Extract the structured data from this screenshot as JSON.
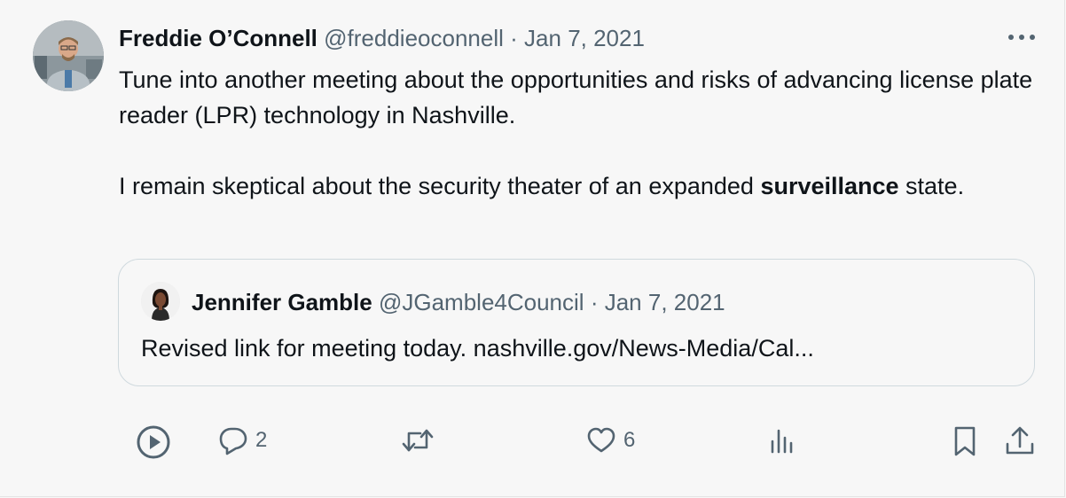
{
  "author": {
    "name": "Freddie O’Connell",
    "handle": "@freddieoconnell",
    "separator": "·",
    "date": "Jan 7, 2021"
  },
  "tweet": {
    "paragraph1": "Tune into another meeting about the opportunities and risks of advancing license plate reader (LPR) technology in Nashville.",
    "paragraph2_before": "I remain skeptical about the security theater of an expanded ",
    "paragraph2_bold": "surveillance",
    "paragraph2_after": " state."
  },
  "quote": {
    "name": "Jennifer Gamble",
    "handle": "@JGamble4Council",
    "separator": "·",
    "date": "Jan 7, 2021",
    "text": "Revised link for meeting today. nashville.gov/News-Media/Cal..."
  },
  "actions": {
    "replies": "2",
    "likes": "6"
  },
  "icons": [
    "play-icon",
    "reply-icon",
    "retweet-icon",
    "like-icon",
    "views-icon",
    "bookmark-icon",
    "share-icon",
    "more-icon"
  ],
  "colors": {
    "text": "#0f1419",
    "secondary": "#536471",
    "border": "#cfd9de",
    "background": "#f7f7f7"
  }
}
